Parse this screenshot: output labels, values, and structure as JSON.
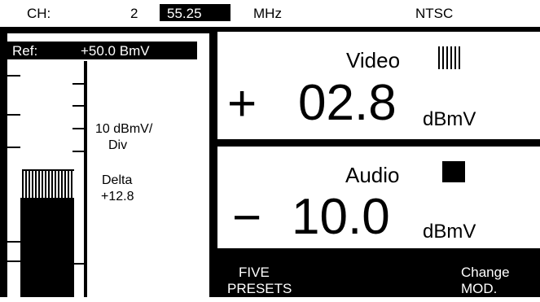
{
  "header": {
    "channel_label": "CH:",
    "channel_value": "2",
    "frequency_value": "55.25",
    "frequency_unit": "MHz",
    "standard": "NTSC"
  },
  "bar_graph": {
    "ref_label": "Ref:",
    "ref_value": "+50.0 BmV",
    "scale_line1": "10 dBmV/",
    "scale_line2": "Div",
    "delta_label": "Delta",
    "delta_value": "+12.8"
  },
  "video": {
    "title": "Video",
    "sign": "+",
    "value": "02.8",
    "unit": "dBmV",
    "icon": "vertical-bars-icon"
  },
  "audio": {
    "title": "Audio",
    "sign": "−",
    "value": "10.0",
    "unit": "dBmV",
    "icon": "solid-square-icon"
  },
  "softkeys": {
    "five_presets_line1": "FIVE",
    "five_presets_line2": "PRESETS",
    "change_mod_line1": "Change",
    "change_mod_line2": "MOD."
  }
}
